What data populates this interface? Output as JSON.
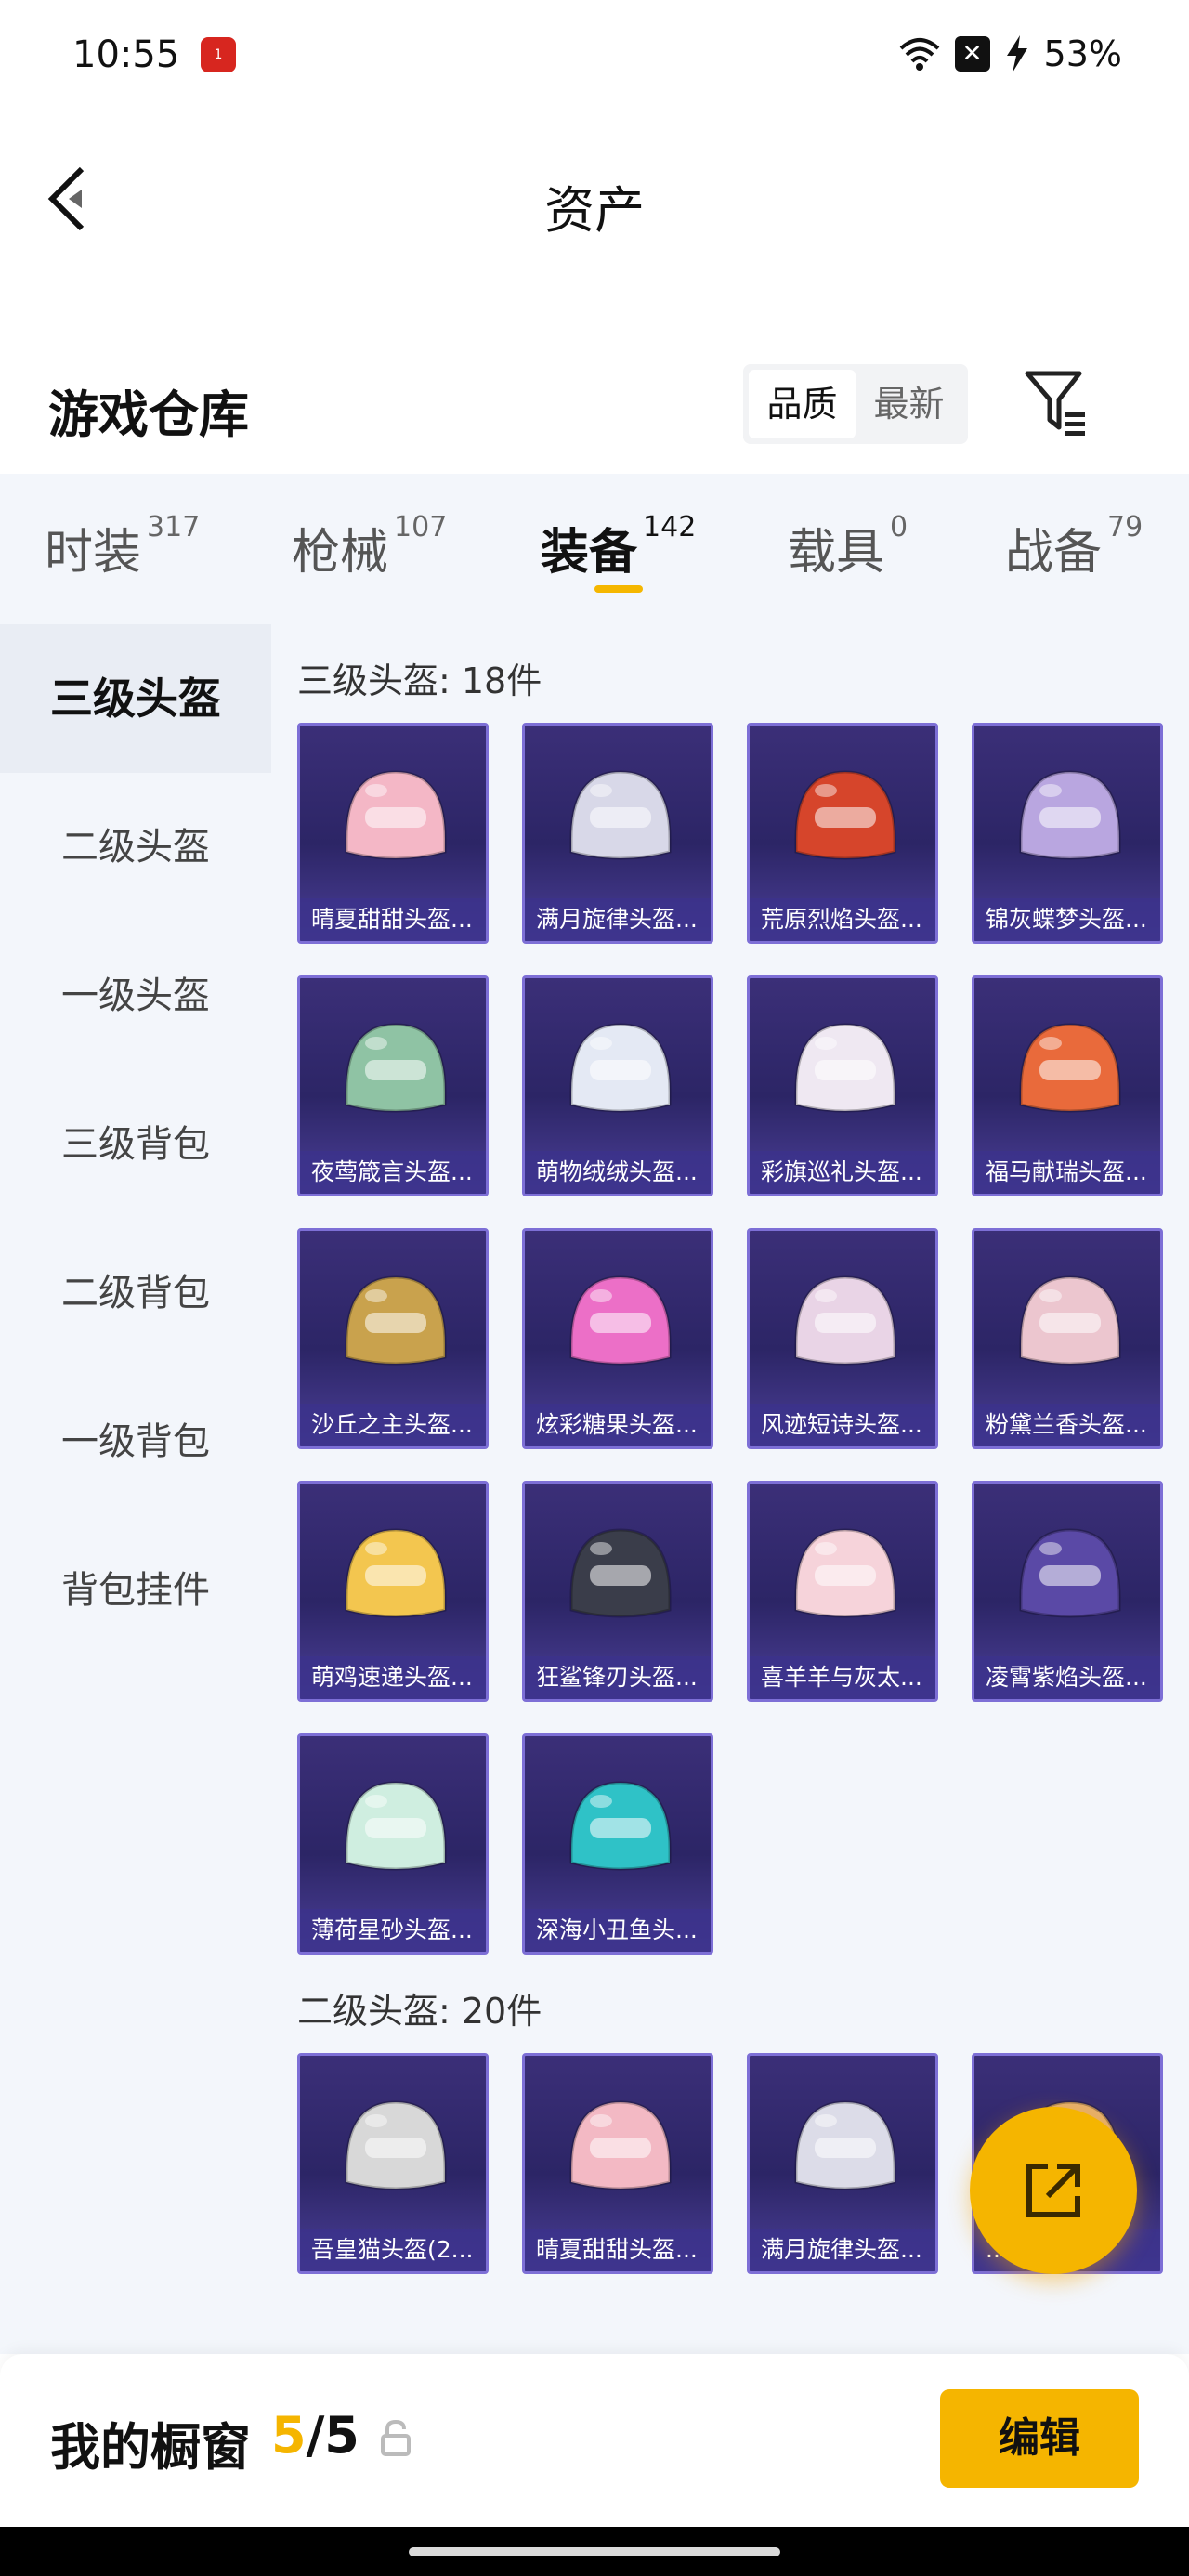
{
  "status_bar": {
    "time": "10:55",
    "battery": "53%",
    "notif_badge": "1"
  },
  "nav": {
    "title": "资产"
  },
  "header": {
    "title": "游戏仓库",
    "sort_options": [
      "品质",
      "最新"
    ],
    "active_sort": "品质"
  },
  "tabs": [
    {
      "label": "时装",
      "count": "317"
    },
    {
      "label": "枪械",
      "count": "107"
    },
    {
      "label": "装备",
      "count": "142",
      "active": true
    },
    {
      "label": "载具",
      "count": "0"
    },
    {
      "label": "战备",
      "count": "79"
    }
  ],
  "sidebar": {
    "items": [
      "三级头盔",
      "二级头盔",
      "一级头盔",
      "三级背包",
      "二级背包",
      "一级背包",
      "背包挂件"
    ],
    "active": "三级头盔"
  },
  "groups": [
    {
      "title": "三级头盔: 18件",
      "items": [
        {
          "name": "晴夏甜甜头盔...",
          "color": "#f4b7c6"
        },
        {
          "name": "满月旋律头盔...",
          "color": "#d8d8e8"
        },
        {
          "name": "荒原烈焰头盔...",
          "color": "#d6452b"
        },
        {
          "name": "锦灰蝶梦头盔...",
          "color": "#b9a6e0"
        },
        {
          "name": "夜莺箴言头盔...",
          "color": "#8fc3a4"
        },
        {
          "name": "萌物绒绒头盔...",
          "color": "#e4e9f4"
        },
        {
          "name": "彩旗巡礼头盔...",
          "color": "#efe8f2"
        },
        {
          "name": "福马献瑞头盔...",
          "color": "#e96a3b"
        },
        {
          "name": "沙丘之主头盔...",
          "color": "#c9a24d"
        },
        {
          "name": "炫彩糖果头盔...",
          "color": "#ec6fc7"
        },
        {
          "name": "风迹短诗头盔...",
          "color": "#e9d4e6"
        },
        {
          "name": "粉黛兰香头盔...",
          "color": "#ecc6cf"
        },
        {
          "name": "萌鸡速递头盔...",
          "color": "#f3c64f"
        },
        {
          "name": "狂鲨锋刃头盔...",
          "color": "#3a3d4a"
        },
        {
          "name": "喜羊羊与灰太...",
          "color": "#f6d3da"
        },
        {
          "name": "凌霄紫焰头盔...",
          "color": "#5a49a6"
        },
        {
          "name": "薄荷星砂头盔...",
          "color": "#cfeee0"
        },
        {
          "name": "深海小丑鱼头...",
          "color": "#2fc2c7"
        }
      ]
    },
    {
      "title": "二级头盔: 20件",
      "items": [
        {
          "name": "吾皇猫头盔(2...",
          "color": "#d8d8d8"
        },
        {
          "name": "晴夏甜甜头盔...",
          "color": "#f3b9c4"
        },
        {
          "name": "满月旋律头盔...",
          "color": "#dcdce8"
        },
        {
          "name": "...头...",
          "color": "#e6b06e"
        }
      ]
    }
  ],
  "bottom_bar": {
    "label": "我的橱窗",
    "count_current": "5",
    "count_total": "/5",
    "edit_label": "编辑"
  },
  "colors": {
    "accent": "#f5b500",
    "card_bg": "#2c2566",
    "card_border": "#7d6fd6"
  }
}
